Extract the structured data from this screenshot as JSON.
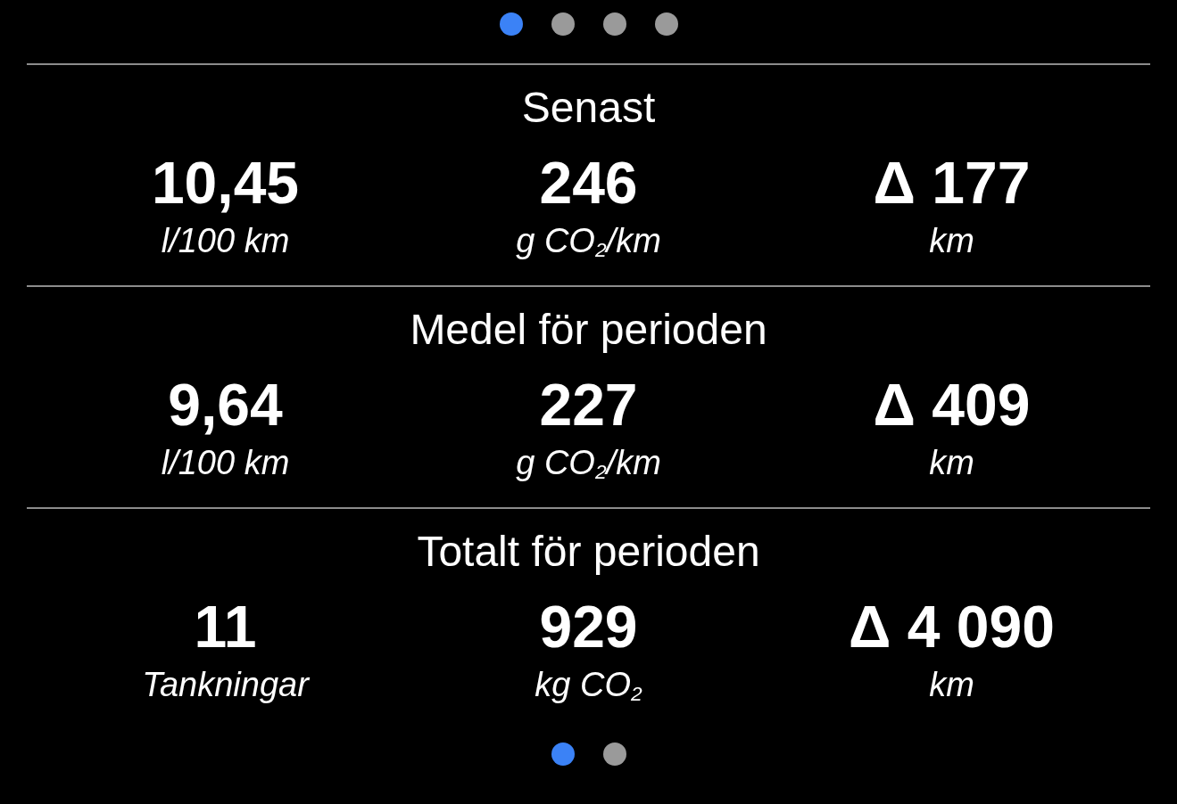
{
  "page_dots": [
    {
      "selected": true
    },
    {
      "selected": false
    },
    {
      "selected": false
    },
    {
      "selected": false
    }
  ],
  "sections": [
    {
      "title": "Senast",
      "stats": [
        {
          "value": "10,45",
          "unit": "l/100 km"
        },
        {
          "value": "246",
          "unit": "g CO$_{2}$/km"
        },
        {
          "value": "Δ 177",
          "unit": "km"
        }
      ]
    },
    {
      "title": "Medel för perioden",
      "stats": [
        {
          "value": "9,64",
          "unit": "l/100 km"
        },
        {
          "value": "227",
          "unit": "g CO$_{2}$/km"
        },
        {
          "value": "Δ 409",
          "unit": "km"
        }
      ]
    },
    {
      "title": "Totalt för perioden",
      "stats": [
        {
          "value": "11",
          "unit": "Tankningar"
        },
        {
          "value": "929",
          "unit": "kg CO$_{2}$"
        },
        {
          "value": "Δ 4 090",
          "unit": "km"
        }
      ]
    }
  ],
  "sub_page_dots": [
    {
      "selected": true
    },
    {
      "selected": false
    }
  ]
}
